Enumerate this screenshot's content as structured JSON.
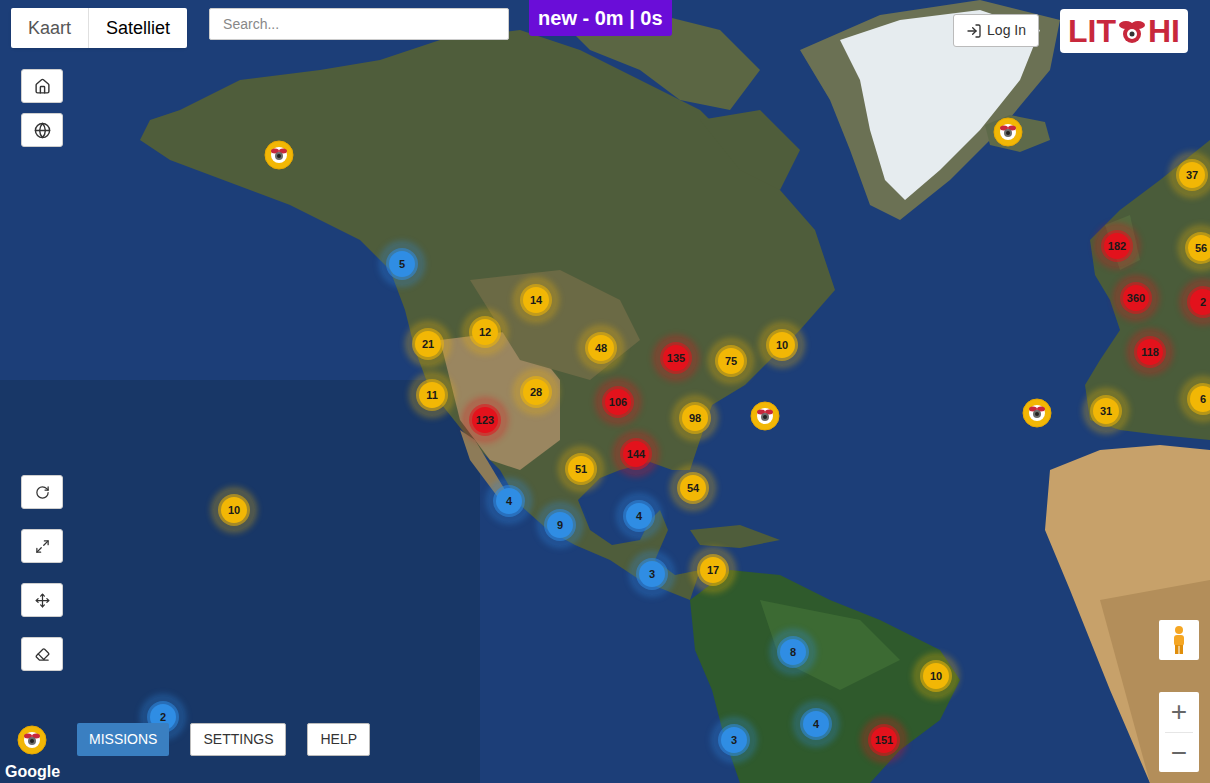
{
  "map_type_tabs": [
    {
      "label": "Kaart",
      "selected": false
    },
    {
      "label": "Satelliet",
      "selected": true
    }
  ],
  "search": {
    "placeholder": "Search..."
  },
  "timer": "new - 0m | 0s",
  "login_button": {
    "label": "Log In"
  },
  "logo": {
    "left": "LIT",
    "right": "HI"
  },
  "clusters": [
    {
      "count": "5",
      "color": "#2f8de4"
    },
    {
      "count": "14",
      "color": "#f2b705"
    },
    {
      "count": "21",
      "color": "#f2b705"
    },
    {
      "count": "12",
      "color": "#f2b705"
    },
    {
      "count": "48",
      "color": "#f2b705"
    },
    {
      "count": "135",
      "color": "#e3121c"
    },
    {
      "count": "75",
      "color": "#f2b705"
    },
    {
      "count": "10",
      "color": "#f2b705"
    },
    {
      "count": "11",
      "color": "#f2b705"
    },
    {
      "count": "28",
      "color": "#f2b705"
    },
    {
      "count": "123",
      "color": "#e3121c"
    },
    {
      "count": "106",
      "color": "#e3121c"
    },
    {
      "count": "98",
      "color": "#f2b705"
    },
    {
      "count": "144",
      "color": "#e3121c"
    },
    {
      "count": "51",
      "color": "#f2b705"
    },
    {
      "count": "4",
      "color": "#2f8de4"
    },
    {
      "count": "9",
      "color": "#2f8de4"
    },
    {
      "count": "4",
      "color": "#2f8de4"
    },
    {
      "count": "54",
      "color": "#f2b705"
    },
    {
      "count": "10",
      "color": "#f2b705"
    },
    {
      "count": "3",
      "color": "#2f8de4"
    },
    {
      "count": "17",
      "color": "#f2b705"
    },
    {
      "count": "8",
      "color": "#2f8de4"
    },
    {
      "count": "10",
      "color": "#f2b705"
    },
    {
      "count": "2",
      "color": "#2f8de4"
    },
    {
      "count": "4",
      "color": "#2f8de4"
    },
    {
      "count": "3",
      "color": "#2f8de4"
    },
    {
      "count": "151",
      "color": "#e3121c"
    },
    {
      "count": "37",
      "color": "#f2b705"
    },
    {
      "count": "182",
      "color": "#e3121c"
    },
    {
      "count": "56",
      "color": "#f2b705"
    },
    {
      "count": "360",
      "color": "#e3121c"
    },
    {
      "count": "2",
      "color": "#e3121c"
    },
    {
      "count": "118",
      "color": "#e3121c"
    },
    {
      "count": "31",
      "color": "#f2b705"
    },
    {
      "count": "6",
      "color": "#f2b705"
    }
  ],
  "bottom_buttons": [
    {
      "label": "MISSIONS",
      "selected": true
    },
    {
      "label": "SETTINGS",
      "selected": false
    },
    {
      "label": "HELP",
      "selected": false
    }
  ],
  "zoom": {
    "in": "+",
    "out": "−"
  },
  "attribution": "Google"
}
